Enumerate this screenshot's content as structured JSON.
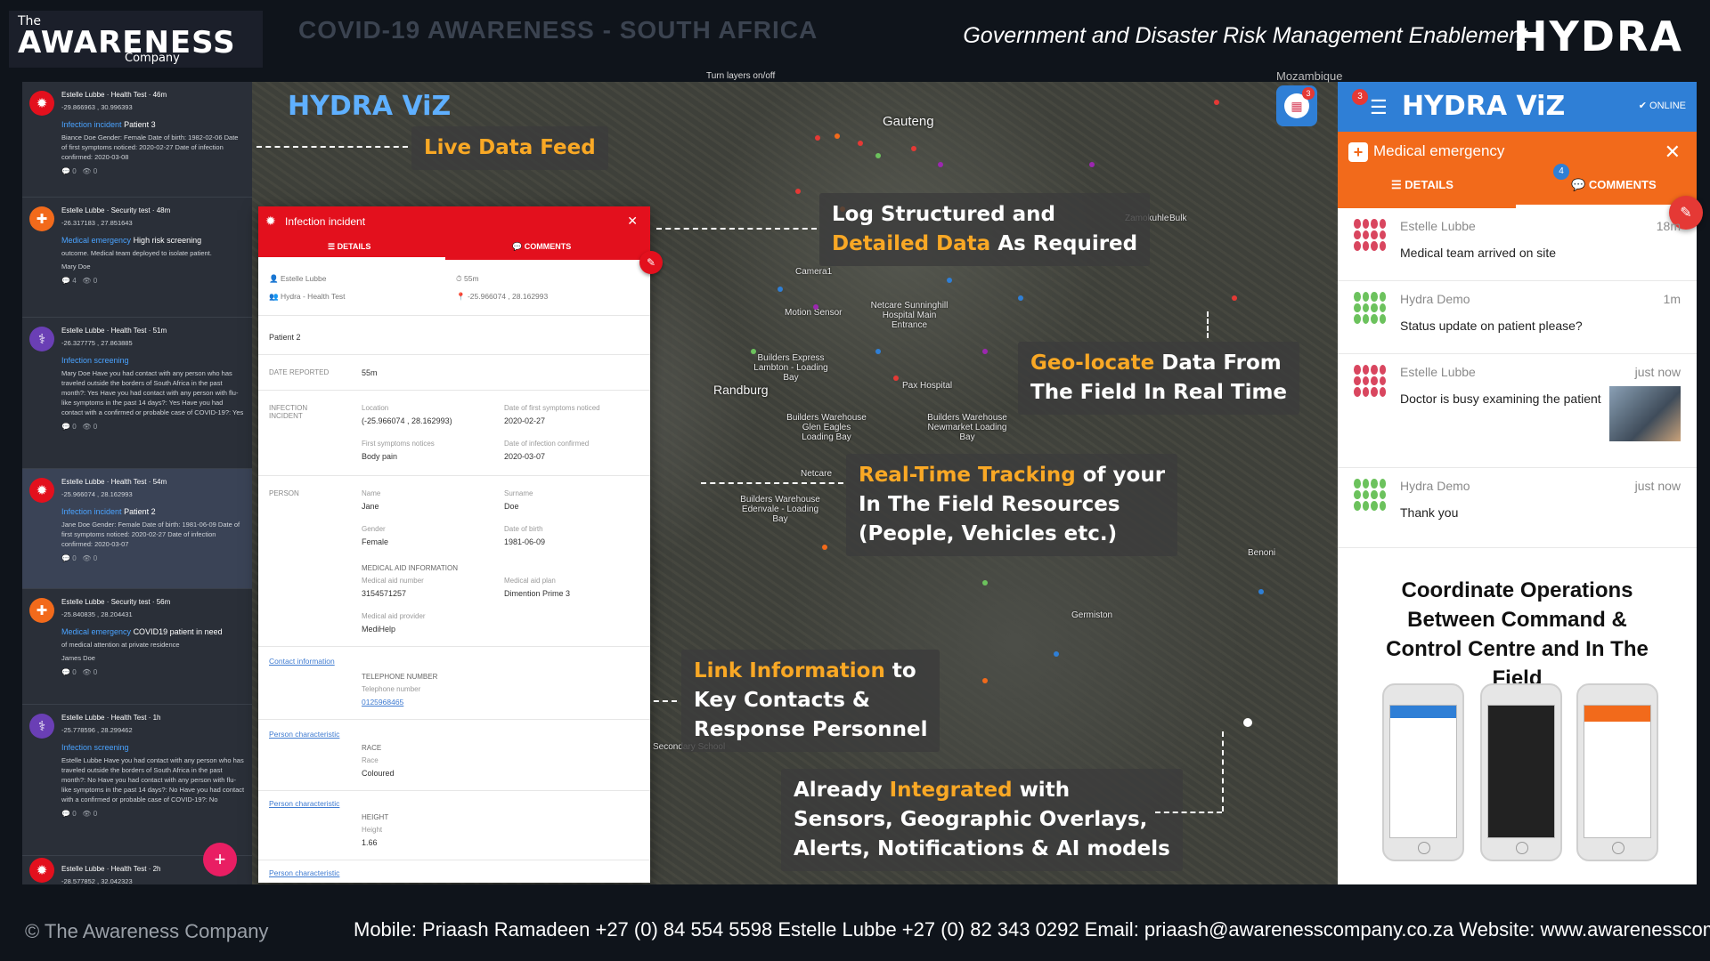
{
  "header": {
    "logo_the": "The",
    "logo_main": "AWARENESS",
    "logo_company": "Company",
    "bg_title": "COVID-19  AWARENESS  -  SOUTH AFRICA",
    "tagline": "Government and Disaster Risk Management Enablement",
    "hydra_logo": "HYDRA"
  },
  "map": {
    "mini_logo": "HYDRA ViZ",
    "layers_btn": "Turn layers on/off",
    "places": {
      "gauteng": "Gauteng",
      "randburg": "Randburg",
      "mozambique": "Mozambique",
      "motion": "Motion Sensor",
      "netcare_sunninghill": "Netcare Sunninghill Hospital Main Entrance",
      "builders_express": "Builders Express Lambton - Loading Bay",
      "builders_warehouse_ge": "Builders Warehouse Glen Eagles Loading Bay",
      "builders_warehouse_nm": "Builders Warehouse Newmarket Loading Bay",
      "builders_warehouse_ed": "Builders Warehouse Edenvale - Loading Bay",
      "pax": "Pax Hospital",
      "germiston": "Germiston",
      "benoni": "Benoni",
      "netcare": "Netcare",
      "secondary_school": "Secondary School",
      "bulk": "Bulk",
      "zamokuhle": "Zamokuhle",
      "camera": "Camera1"
    },
    "grid_badge": "3"
  },
  "feed": {
    "items": [
      {
        "user": "Estelle Lubbe",
        "group": "Health Test",
        "age": "46m",
        "coords": "-29.866963 , 30.996393",
        "type": "Infection incident",
        "subject": "Patient 3",
        "body": "Biance Doe Gender: Female Date of birth: 1982-02-06 Date of first symptoms noticed: 2020-02-27 Date of infection confirmed: 2020-03-08",
        "comments": "0",
        "views": "0"
      },
      {
        "user": "Estelle Lubbe",
        "group": "Security test",
        "age": "48m",
        "coords": "-26.317183 , 27.851643",
        "type": "Medical emergency",
        "subject": "High risk screening",
        "body": "outcome. Medical team deployed to isolate patient.",
        "author": "Mary Doe",
        "comments": "4",
        "views": "0"
      },
      {
        "user": "Estelle Lubbe",
        "group": "Health Test",
        "age": "51m",
        "coords": "-26.327775 , 27.863885",
        "type": "Infection screening",
        "subject": "",
        "body": "Mary Doe Have you had contact with any person who has traveled outside the borders of South Africa in the past month?: Yes Have you had contact with any person with flu-like symptoms in the past 14 days?: Yes Have you had contact with a confirmed or probable case of COVID-19?: Yes",
        "comments": "0",
        "views": "0"
      },
      {
        "user": "Estelle Lubbe",
        "group": "Health Test",
        "age": "54m",
        "coords": "-25.966074 , 28.162993",
        "type": "Infection incident",
        "subject": "Patient 2",
        "body": "Jane Doe Gender: Female Date of birth: 1981-06-09 Date of first symptoms noticed: 2020-02-27 Date of infection confirmed: 2020-03-07",
        "comments": "0",
        "views": "0"
      },
      {
        "user": "Estelle Lubbe",
        "group": "Security test",
        "age": "56m",
        "coords": "-25.840835 , 28.204431",
        "type": "Medical emergency",
        "subject": "COVID19 patient in need",
        "body": "of medical attention at private residence",
        "author": "James Doe",
        "comments": "0",
        "views": "0"
      },
      {
        "user": "Estelle Lubbe",
        "group": "Health Test",
        "age": "1h",
        "coords": "-25.778596 , 28.299462",
        "type": "Infection screening",
        "subject": "",
        "body": "Estelle Lubbe Have you had contact with any person who has traveled outside the borders of South Africa in the past month?: No Have you had contact with any person with flu-like symptoms in the past 14 days?: No Have you had contact with a confirmed or probable case of COVID-19?: No",
        "comments": "0",
        "views": "0"
      },
      {
        "user": "Estelle Lubbe",
        "group": "Health Test",
        "age": "2h",
        "coords": "-28.577852 , 32.042323",
        "type": "",
        "subject": "",
        "body": "",
        "comments": "",
        "views": ""
      }
    ],
    "fab": "+"
  },
  "incident": {
    "title": "Infection incident",
    "tab_details": "DETAILS",
    "tab_comments": "COMMENTS",
    "user": "Estelle Lubbe",
    "group": "Hydra - Health Test",
    "age": "55m",
    "coords": "-25.966074 , 28.162993",
    "subject": "Patient 2",
    "date_reported_label": "DATE REPORTED",
    "date_reported": "55m",
    "infection_label": "INFECTION INCIDENT",
    "location_label": "Location",
    "location": "(-25.966074 , 28.162993)",
    "first_symptoms_label": "Date of first symptoms noticed",
    "first_symptoms": "2020-02-27",
    "symptoms_label": "First symptoms notices",
    "symptoms": "Body pain",
    "confirmed_label": "Date of infection confirmed",
    "confirmed": "2020-03-07",
    "person_label": "PERSON",
    "name_label": "Name",
    "name": "Jane",
    "surname_label": "Surname",
    "surname": "Doe",
    "gender_label": "Gender",
    "gender": "Female",
    "dob_label": "Date of birth",
    "dob": "1981-06-09",
    "medaid_head": "MEDICAL AID INFORMATION",
    "medaid_num_label": "Medical aid number",
    "medaid_num": "3154571257",
    "medaid_plan_label": "Medical aid plan",
    "medaid_plan": "Dimention Prime 3",
    "medaid_prov_label": "Medical aid provider",
    "medaid_prov": "MediHelp",
    "contact_link": "Contact information",
    "tel_head": "TELEPHONE NUMBER",
    "tel_label": "Telephone number",
    "tel": "0125968465",
    "pc_link1": "Person characteristic",
    "race_head": "RACE",
    "race_label": "Race",
    "race": "Coloured",
    "pc_link2": "Person characteristic",
    "height_head": "HEIGHT",
    "height_label": "Height",
    "height": "1.66",
    "pc_link3": "Person characteristic"
  },
  "mobile": {
    "badge": "3",
    "logo": "HYDRA ViZ",
    "online": "ONLINE",
    "title": "Medical emergency",
    "tab_details": "DETAILS",
    "tab_comments": "COMMENTS",
    "comments_badge": "4",
    "messages": [
      {
        "name": "Estelle Lubbe",
        "time": "18m",
        "text": "Medical team arrived on site",
        "color": "#d9465f"
      },
      {
        "name": "Hydra Demo",
        "time": "1m",
        "text": "Status update on patient please?",
        "color": "#6cc25d"
      },
      {
        "name": "Estelle Lubbe",
        "time": "just now",
        "text": "Doctor is busy examining the patient",
        "color": "#d9465f"
      },
      {
        "name": "Hydra Demo",
        "time": "just now",
        "text": "Thank you",
        "color": "#6cc25d"
      }
    ],
    "coordinate_text": "Coordinate Operations Between Command & Control Centre and In The Field"
  },
  "callouts": {
    "live_feed": "Live Data Feed",
    "log_1": "Log Structured and",
    "log_hl": "Detailed Data",
    "log_2": "As Required",
    "geo_hl": "Geo-locate",
    "geo_1": "Data From",
    "geo_2": "The Field In Real Time",
    "track_hl": "Real-Time Tracking",
    "track_1": "of your",
    "track_2": "In The Field Resources",
    "track_3": "(People, Vehicles etc.)",
    "link_hl": "Link Information",
    "link_1": "to",
    "link_2": "Key Contacts &",
    "link_3": "Response Personnel",
    "int_1": "Already",
    "int_hl": "Integrated",
    "int_2": "with",
    "int_3": "Sensors, Geographic Overlays,",
    "int_4": "Alerts, Notifications & AI models"
  },
  "footer": {
    "copyright": "© The Awareness Company",
    "contact": "Mobile:  Priaash Ramadeen +27 (0) 84 554 5598   Estelle Lubbe +27 (0) 82 343 0292  Email: priaash@awarenesscompany.co.za  Website: www.awarenesscompany.co.za"
  },
  "colors": {
    "accent_red": "#e3101d",
    "accent_orange": "#f26a1b",
    "accent_blue": "#2f7fd6",
    "highlight": "#f9a825"
  }
}
